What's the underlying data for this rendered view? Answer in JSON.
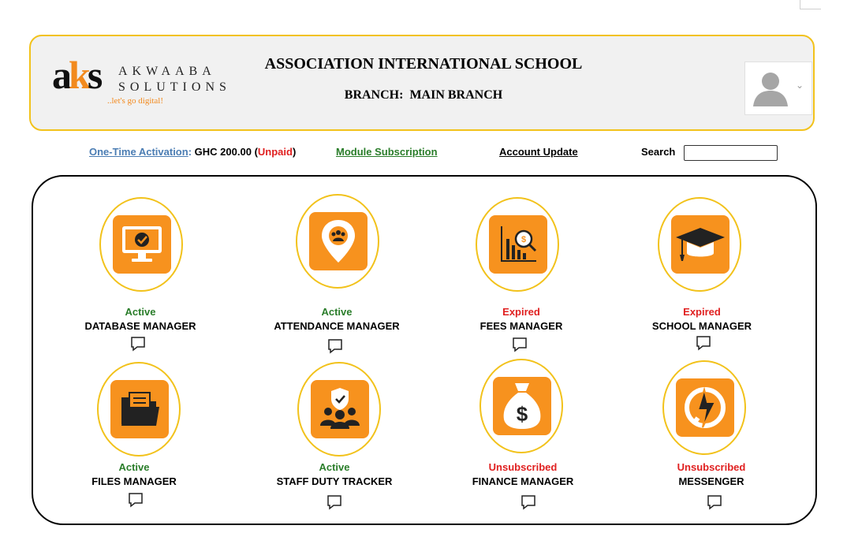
{
  "header": {
    "logo": {
      "mark": "aks",
      "line1": "AKWAABA",
      "line2": "SOLUTIONS",
      "tagline": "..let's go digital!"
    },
    "school_name": "ASSOCIATION INTERNATIONAL SCHOOL",
    "branch_label": "BRANCH:",
    "branch_value": "MAIN BRANCH",
    "avatar_icon": "user-avatar-icon"
  },
  "nav": {
    "activation_link": "One-Time  Activation",
    "activation_colon": ":",
    "activation_amount": "GHC 200.00",
    "activation_status": "Unpaid",
    "module_subscription": "Module  Subscription",
    "account_update": "Account Update",
    "search_label": "Search",
    "search_value": ""
  },
  "colors": {
    "accent_orange": "#f7921e",
    "ring_gold": "#f2c21b",
    "active_green": "#2a7d2a",
    "alert_red": "#e02020",
    "link_blue": "#4b7db3"
  },
  "modules": [
    {
      "name": "DATABASE MANAGER",
      "status": "Active",
      "icon": "monitor-check-icon"
    },
    {
      "name": "ATTENDANCE MANAGER",
      "status": "Active",
      "icon": "location-group-icon"
    },
    {
      "name": "FEES MANAGER",
      "status": "Expired",
      "icon": "chart-search-icon"
    },
    {
      "name": "SCHOOL MANAGER",
      "status": "Expired",
      "icon": "graduation-cap-icon"
    },
    {
      "name": "FILES MANAGER",
      "status": "Active",
      "icon": "folder-icon"
    },
    {
      "name": "STAFF DUTY TRACKER",
      "status": "Active",
      "icon": "staff-shield-icon"
    },
    {
      "name": "FINANCE MANAGER",
      "status": "Unsubscribed",
      "icon": "money-bag-icon"
    },
    {
      "name": "MESSENGER",
      "status": "Unsubscribed",
      "icon": "messenger-icon"
    }
  ]
}
